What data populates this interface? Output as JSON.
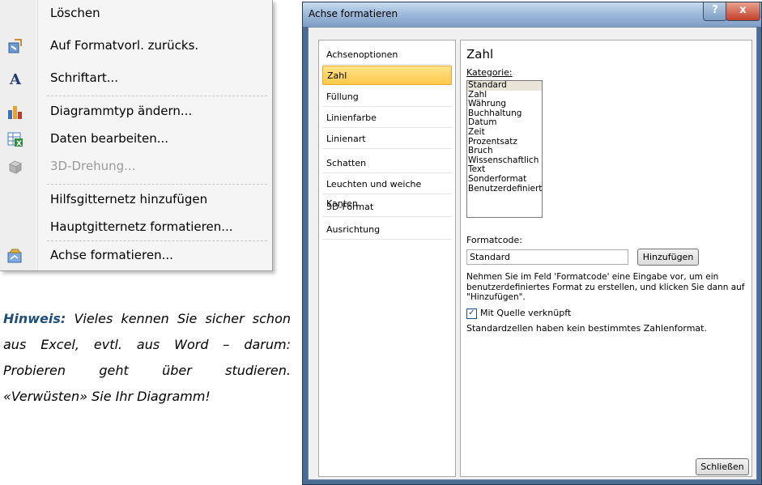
{
  "context_menu": {
    "items": [
      {
        "label": "Löschen",
        "icon": "none",
        "disabled": false
      },
      {
        "label": "Auf Formatvorl. zurücks.",
        "icon": "reset-style-icon",
        "disabled": false
      },
      {
        "label": "Schriftart...",
        "icon": "font-icon",
        "disabled": false
      },
      {
        "label": "Diagrammtyp ändern...",
        "icon": "chart-type-icon",
        "disabled": false
      },
      {
        "label": "Daten bearbeiten...",
        "icon": "edit-data-icon",
        "disabled": false
      },
      {
        "label": "3D-Drehung...",
        "icon": "3d-rotation-icon",
        "disabled": true
      },
      {
        "label": "Hilfsgitternetz hinzufügen",
        "icon": "none",
        "disabled": false
      },
      {
        "label": "Hauptgitternetz formatieren...",
        "icon": "none",
        "disabled": false
      },
      {
        "label": "Achse formatieren...",
        "icon": "format-axis-icon",
        "disabled": false
      }
    ]
  },
  "hint": {
    "label": "Hinweis:",
    "text": " Vieles kennen Sie sicher schon aus Excel, evtl. aus Word – darum: Probieren geht über studieren. «Verwüsten» Sie Ihr Diagramm!"
  },
  "dialog": {
    "title": "Achse formatieren",
    "help_button": "?",
    "close_button": "x",
    "nav": [
      "Achsenoptionen",
      "Zahl",
      "Füllung",
      "Linienfarbe",
      "Linienart",
      "Schatten",
      "Leuchten und weiche Kanten",
      "3D-Format",
      "Ausrichtung"
    ],
    "selected_nav": "Zahl",
    "panel": {
      "title": "Zahl",
      "kategorie_label": "Kategorie:",
      "categories": [
        "Standard",
        "Zahl",
        "Währung",
        "Buchhaltung",
        "Datum",
        "Zeit",
        "Prozentsatz",
        "Bruch",
        "Wissenschaftlich",
        "Text",
        "Sonderformat",
        "Benutzerdefiniert"
      ],
      "selected_category": "Standard",
      "formatcode_label": "Formatcode:",
      "formatcode_value": "Standard",
      "add_button": "Hinzufügen",
      "description": "Nehmen Sie im Feld 'Formatcode' eine Eingabe vor, um ein benutzerdefiniertes Format zu erstellen, und klicken Sie dann auf \"Hinzufügen\".",
      "linked_checkbox_label": "Mit Quelle verknüpft",
      "linked_checked": true,
      "note": "Standardzellen haben kein bestimmtes Zahlenformat."
    },
    "close_label": "Schließen"
  }
}
